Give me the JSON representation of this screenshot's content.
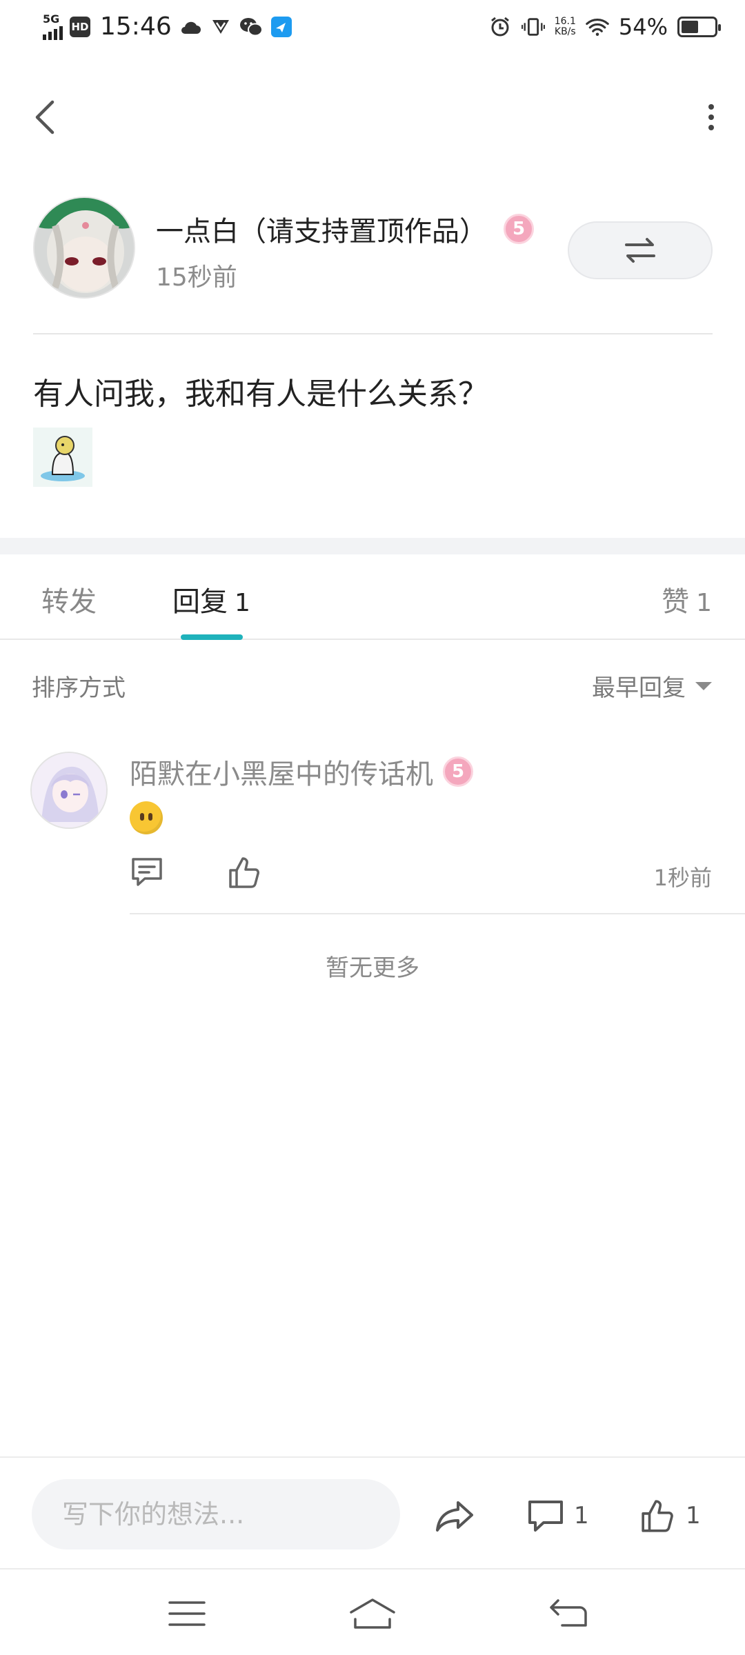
{
  "status_bar": {
    "network": "5G",
    "hd": "HD",
    "time": "15:46",
    "net_speed_value": "16.1",
    "net_speed_unit": "KB/s",
    "battery": "54%",
    "battery_level": 0.54
  },
  "post": {
    "author_name": "一点白（请支持置顶作品）",
    "author_level": "5",
    "time_ago": "15秒前",
    "text": "有人问我，我和有人是什么关系？"
  },
  "tabs": [
    {
      "label": "转发",
      "count": ""
    },
    {
      "label": "回复",
      "count": "1"
    },
    {
      "label": "赞",
      "count": "1"
    }
  ],
  "active_tab": 1,
  "sort": {
    "label": "排序方式",
    "selected": "最早回复"
  },
  "replies": [
    {
      "author": "陌默在小黑屋中的传话机",
      "level": "5",
      "time": "1秒前"
    }
  ],
  "no_more_text": "暂无更多",
  "bottom_bar": {
    "placeholder": "写下你的想法...",
    "comment_count": "1",
    "like_count": "1"
  },
  "colors": {
    "accent": "#1fb2bb",
    "level_badge": "#f4a7bd"
  }
}
